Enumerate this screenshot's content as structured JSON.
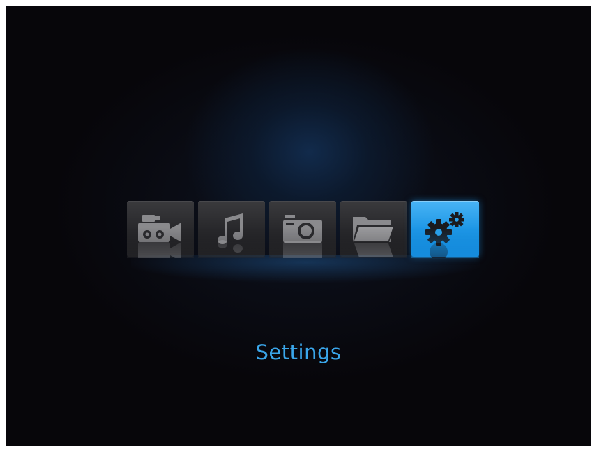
{
  "menu": {
    "items": [
      {
        "id": "video",
        "icon": "video-camera-icon",
        "active": false
      },
      {
        "id": "music",
        "icon": "music-note-icon",
        "active": false
      },
      {
        "id": "photo",
        "icon": "camera-icon",
        "active": false
      },
      {
        "id": "files",
        "icon": "folder-icon",
        "active": false
      },
      {
        "id": "settings",
        "icon": "gears-icon",
        "active": true
      }
    ],
    "selected_label": "Settings"
  },
  "colors": {
    "background": "#07060a",
    "tile": "#2c2c2f",
    "icon": "#8a8a8d",
    "accent": "#1e97e6",
    "label": "#3aa6ea"
  }
}
